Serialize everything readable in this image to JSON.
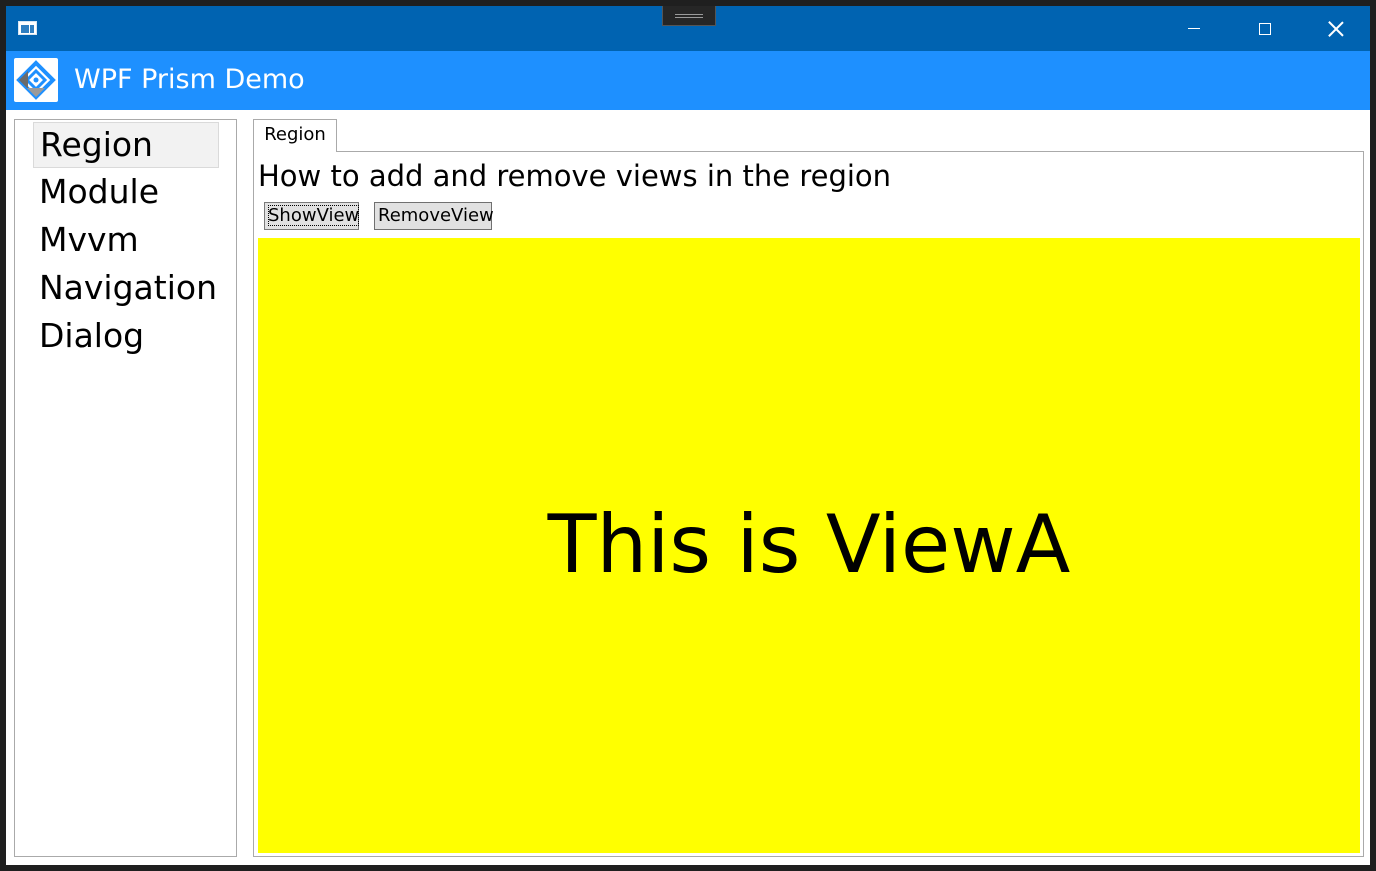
{
  "window": {
    "controls": {
      "minimize_icon": "minimize-icon",
      "maximize_icon": "maximize-icon",
      "close_icon": "close-icon"
    },
    "titlebar_color": "#0063b1"
  },
  "header": {
    "title": "WPF Prism Demo",
    "background": "#1e90ff",
    "logo_icon": "prism-logo-icon"
  },
  "nav": {
    "items": [
      {
        "label": "Region",
        "selected": true
      },
      {
        "label": "Module",
        "selected": false
      },
      {
        "label": "Mvvm",
        "selected": false
      },
      {
        "label": "Navigation",
        "selected": false
      },
      {
        "label": "Dialog",
        "selected": false
      }
    ]
  },
  "tabs": [
    {
      "label": "Region",
      "active": true
    }
  ],
  "content": {
    "heading": "How to add and remove views in the region",
    "buttons": {
      "show_view": "ShowView",
      "remove_view": "RemoveView"
    },
    "view": {
      "text": "This is ViewA",
      "background": "#ffff00"
    }
  }
}
